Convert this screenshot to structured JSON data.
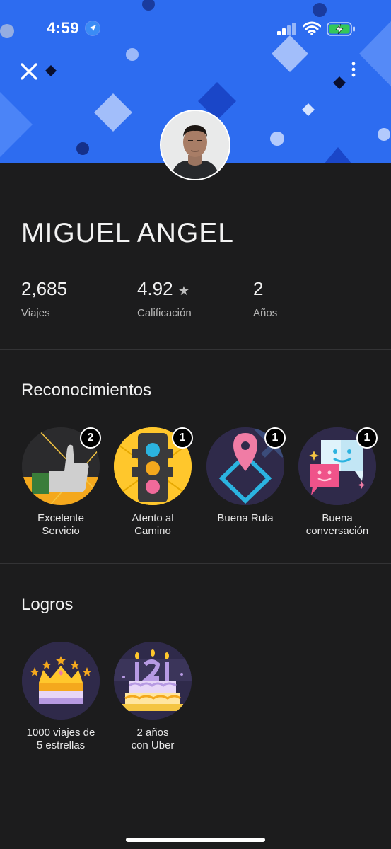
{
  "status_bar": {
    "time": "4:59"
  },
  "profile": {
    "name": "MIGUEL ANGEL"
  },
  "stats": [
    {
      "value": "2,685",
      "label": "Viajes"
    },
    {
      "value": "4.92",
      "label": "Calificación"
    },
    {
      "value": "2",
      "label": "Años"
    }
  ],
  "recognitions": {
    "title": "Reconocimientos",
    "items": [
      {
        "label": "Excelente\nServicio",
        "count": "2",
        "icon": "thumbs-up-icon"
      },
      {
        "label": "Atento al\nCamino",
        "count": "1",
        "icon": "traffic-light-icon"
      },
      {
        "label": "Buena Ruta",
        "count": "1",
        "icon": "map-pin-route-icon"
      },
      {
        "label": "Buena\nconversación",
        "count": "1",
        "icon": "chat-bubbles-icon"
      }
    ]
  },
  "achievements": {
    "title": "Logros",
    "items": [
      {
        "label": "1000 viajes de\n5 estrellas",
        "icon": "crown-stars-icon"
      },
      {
        "label": "2 años\ncon Uber",
        "icon": "birthday-cake-icon"
      }
    ]
  },
  "colors": {
    "header_blue": "#2d6cf0",
    "background": "#1c1c1d",
    "badge_yellow": "#ffc72c",
    "badge_dark": "#2f2a4a"
  }
}
